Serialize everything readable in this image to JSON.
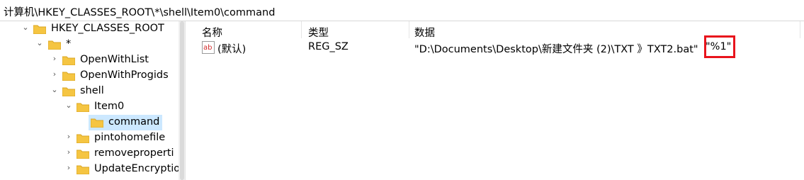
{
  "address_bar": {
    "path": "计算机\\HKEY_CLASSES_ROOT\\*\\shell\\Item0\\command"
  },
  "tree": {
    "nodes": [
      {
        "label": "HKEY_CLASSES_ROOT",
        "expanded": true
      },
      {
        "label": "*",
        "expanded": true
      },
      {
        "label": "OpenWithList",
        "expanded": false
      },
      {
        "label": "OpenWithProgids",
        "expanded": false
      },
      {
        "label": "shell",
        "expanded": true
      },
      {
        "label": "Item0",
        "expanded": true
      },
      {
        "label": "command",
        "selected": true
      },
      {
        "label": "pintohomefile",
        "expanded": false
      },
      {
        "label": "removeproperti",
        "expanded": false
      },
      {
        "label": "UpdateEncryptio",
        "expanded": false
      }
    ]
  },
  "list": {
    "columns": {
      "name": "名称",
      "type": "类型",
      "data": "数据"
    },
    "rows": [
      {
        "name": "(默认)",
        "type": "REG_SZ",
        "data": "\"D:\\Documents\\Desktop\\新建文件夹 (2)\\TXT 》TXT2.bat\"",
        "highlighted_arg": "\"%1\""
      }
    ]
  },
  "colors": {
    "selection": "#cce8ff",
    "highlight_box": "#e8141c",
    "folder": "#f5c542"
  }
}
